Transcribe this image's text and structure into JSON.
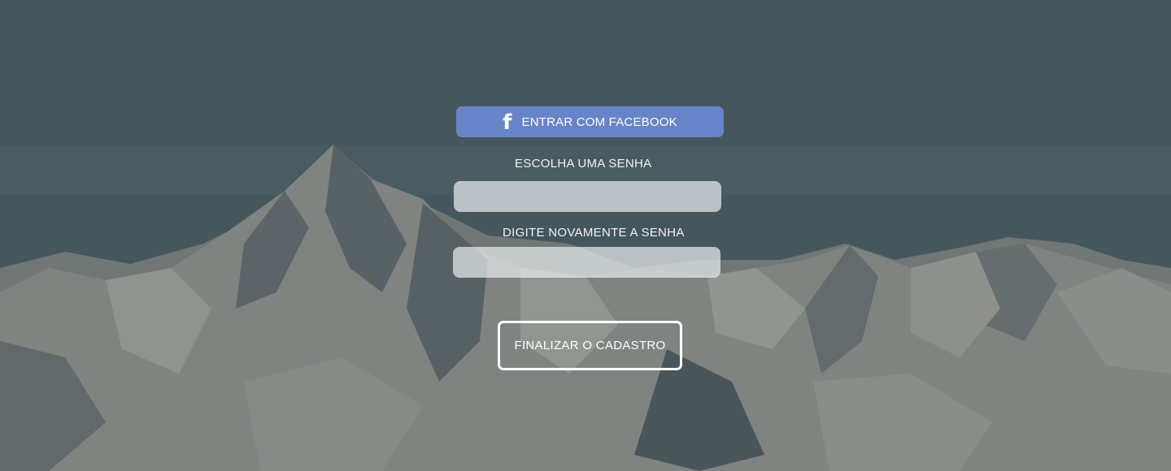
{
  "background": {
    "description_icon": "mountain-range-background"
  },
  "facebook_login": {
    "icon": "facebook-icon",
    "icon_glyph": "f",
    "label": "ENTRAR COM FACEBOOK",
    "color": "#6884c8"
  },
  "password_field": {
    "label": "ESCOLHA UMA SENHA",
    "value": "",
    "placeholder": ""
  },
  "confirm_password_field": {
    "label": "DIGITE NOVAMENTE A SENHA",
    "value": "",
    "placeholder": ""
  },
  "submit": {
    "label": "FINALIZAR O CADASTRO"
  }
}
